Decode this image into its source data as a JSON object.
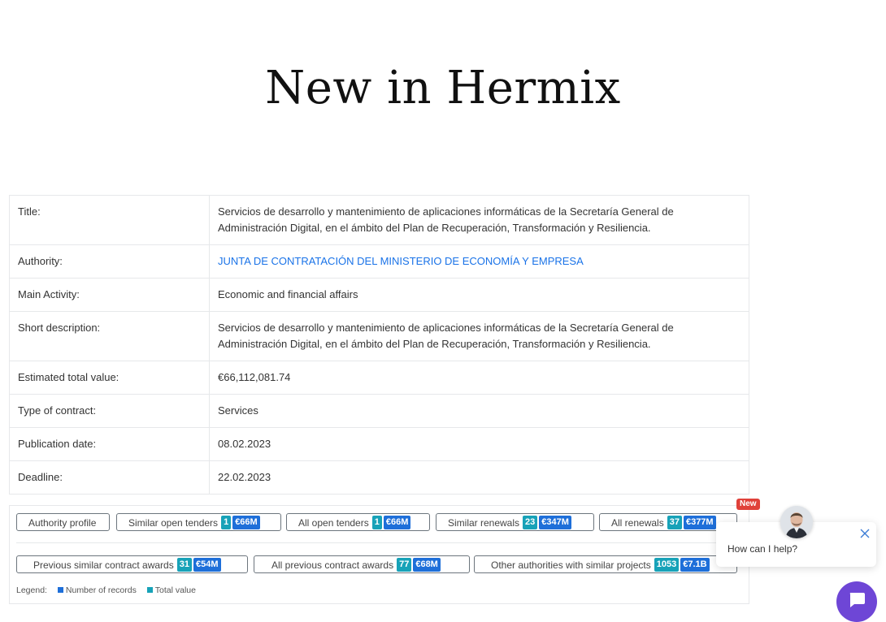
{
  "page": {
    "title": "New in Hermix"
  },
  "details": {
    "rows": [
      {
        "label": "Title:",
        "value": "Servicios de desarrollo y mantenimiento de aplicaciones informáticas de la Secretaría General de Administración Digital, en el ámbito del Plan de Recuperación, Transformación y Resiliencia."
      },
      {
        "label": "Authority:",
        "value": "JUNTA DE CONTRATACIÓN DEL MINISTERIO DE ECONOMÍA Y EMPRESA"
      },
      {
        "label": "Main Activity:",
        "value": "Economic and financial affairs"
      },
      {
        "label": "Short description:",
        "value": "Servicios de desarrollo y mantenimiento de aplicaciones informáticas de la Secretaría General de Administración Digital, en el ámbito del Plan de Recuperación, Transformación y Resiliencia."
      },
      {
        "label": "Estimated total value:",
        "value": "€66,112,081.74"
      },
      {
        "label": "Type of contract:",
        "value": "Services"
      },
      {
        "label": "Publication date:",
        "value": "08.02.2023"
      },
      {
        "label": "Deadline:",
        "value": "22.02.2023"
      }
    ]
  },
  "actions": {
    "authority_profile": {
      "label": "Authority profile"
    },
    "similar_open_tenders": {
      "label": "Similar open tenders",
      "count": "1",
      "value": "€66M"
    },
    "all_open_tenders": {
      "label": "All open tenders",
      "count": "1",
      "value": "€66M"
    },
    "similar_renewals": {
      "label": "Similar renewals",
      "count": "23",
      "value": "€347M"
    },
    "all_renewals": {
      "label": "All renewals",
      "count": "37",
      "value": "€377M"
    },
    "previous_similar_awards": {
      "label": "Previous similar contract awards",
      "count": "31",
      "value": "€54M"
    },
    "all_previous_awards": {
      "label": "All previous contract awards",
      "count": "77",
      "value": "€68M"
    },
    "other_authorities": {
      "label": "Other authorities with similar projects",
      "count": "1053",
      "value": "€7.1B"
    }
  },
  "legend": {
    "title": "Legend:",
    "records": "Number of records",
    "total": "Total value",
    "colors": {
      "records": "#1e6fd9",
      "total": "#17a2b8"
    }
  },
  "chat": {
    "badge": "New",
    "prompt": "How can I help?",
    "launcher_color": "#6e46d6"
  }
}
